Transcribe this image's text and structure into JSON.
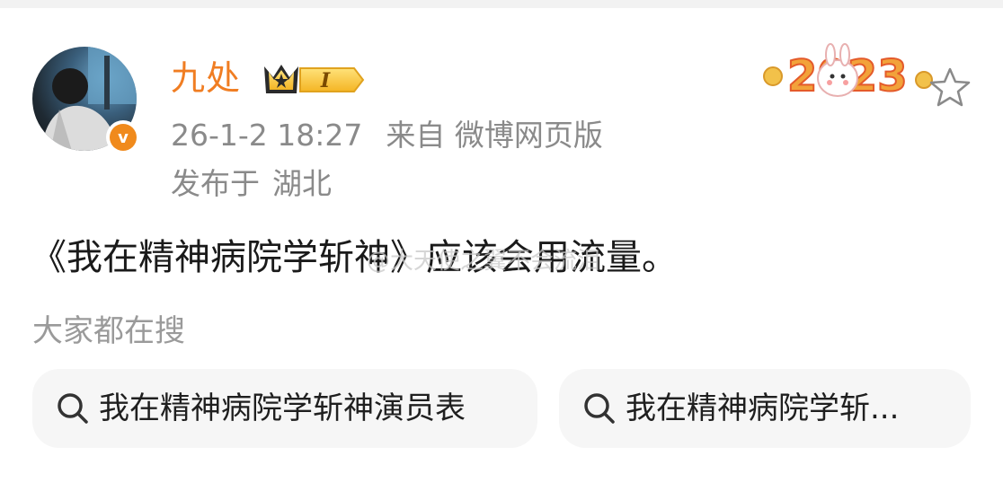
{
  "post": {
    "username": "九处",
    "level_badge": "I",
    "time": "26-1-2 18:27",
    "source": "来自 微博网页版",
    "location_prefix": "发布于",
    "location": "湖北",
    "verified_mark": "v",
    "decoration_text": "2023",
    "text": "《我在精神病院学斩神》应该会用流量。",
    "watermark": "@大天使之翼不会流泪"
  },
  "hot_search": {
    "title": "大家都在搜",
    "items": [
      {
        "label": "我在精神病院学斩神演员表"
      },
      {
        "label": "我在精神病院学斩..."
      }
    ]
  },
  "colors": {
    "username": "#f07d22",
    "meta": "#8a8a8a",
    "chip_bg": "#f6f6f6",
    "verified": "#f08a1c"
  },
  "icons": [
    "avatar",
    "verified-v-icon",
    "crown-level-icon",
    "rabbit-2023-decoration",
    "star-icon",
    "search-icon"
  ]
}
